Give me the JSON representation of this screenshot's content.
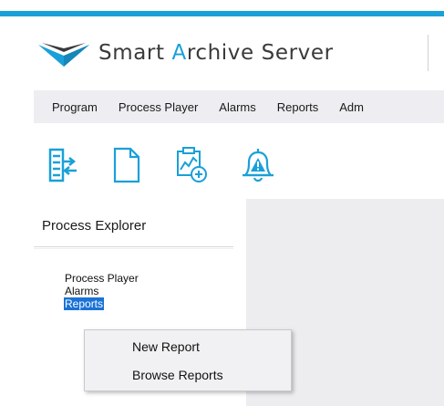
{
  "app": {
    "title_prefix": "Smart ",
    "title_accent": "A",
    "title_suffix": "rchive Server",
    "brand_color": "#1aa0d8",
    "logo_icon": "chevron-logo"
  },
  "menubar": {
    "items": [
      "Program",
      "Process Player",
      "Alarms",
      "Reports",
      "Adm"
    ]
  },
  "toolbar": {
    "icons": [
      "import-export-icon",
      "new-document-icon",
      "add-chart-icon",
      "alarm-bell-icon"
    ]
  },
  "explorer": {
    "title": "Process Explorer",
    "items": [
      "Process Player",
      "Alarms",
      "Reports"
    ],
    "selected": "Reports",
    "selection_color": "#1a72d6"
  },
  "context_menu": {
    "items": [
      "New Report",
      "Browse Reports"
    ]
  }
}
